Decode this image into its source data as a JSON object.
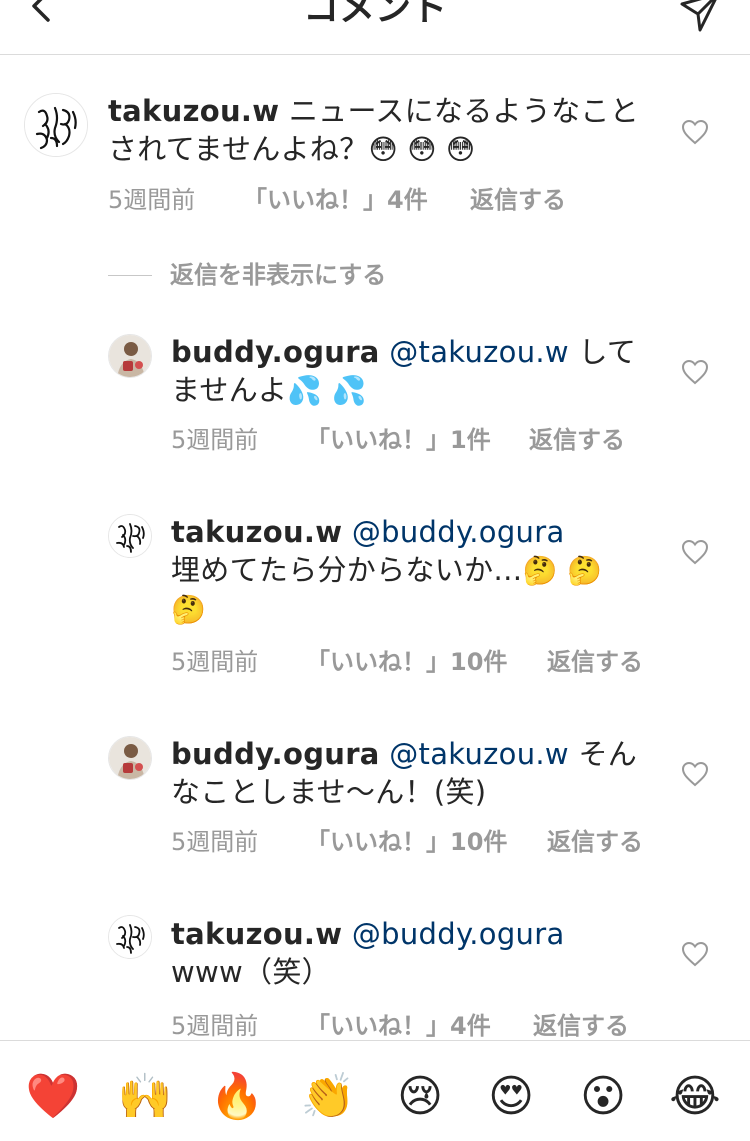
{
  "header": {
    "title": "コメント",
    "back_icon": "chevron-left-icon",
    "send_icon": "paper-plane-icon"
  },
  "comments": [
    {
      "username": "takuzou.w",
      "mention": "",
      "text_line1": " ニュースになるようなこと",
      "text_line2": "されてませんよね？",
      "emojis": "😳 😳 😳",
      "time": "5週間前",
      "likes": "「いいね！」4件",
      "reply": "返信する",
      "avatar": "calligraphy-avatar"
    },
    {
      "username": "buddy.ogura",
      "mention": "@takuzou.w",
      "text_line1": " して",
      "text_line2": "ませんよ",
      "emojis": "💦 💦",
      "time": "5週間前",
      "likes": "「いいね！」1件",
      "reply": "返信する",
      "avatar": "photo-avatar"
    },
    {
      "username": "takuzou.w",
      "mention": "@buddy.ogura",
      "text_line2": "埋めてたら分からないか…",
      "emojis_inline": "🤔 🤔",
      "emojis_line3": "🤔",
      "time": "5週間前",
      "likes": "「いいね！」10件",
      "reply": "返信する",
      "avatar": "calligraphy-avatar"
    },
    {
      "username": "buddy.ogura",
      "mention": "@takuzou.w",
      "text_line1": " そん",
      "text_line2": "なことしませ〜ん！(笑)",
      "time": "5週間前",
      "likes": "「いいね！」10件",
      "reply": "返信する",
      "avatar": "photo-avatar"
    },
    {
      "username": "takuzou.w",
      "mention": "@buddy.ogura",
      "text_line2": "www（笑）",
      "time": "5週間前",
      "likes": "「いいね！」4件",
      "reply": "返信する",
      "avatar": "calligraphy-avatar"
    }
  ],
  "hide_replies": "返信を非表示にする",
  "emoji_bar": [
    "❤️",
    "🙌",
    "🔥",
    "👏",
    "😢",
    "😍",
    "😮",
    "😂"
  ],
  "colors": {
    "text": "#262626",
    "mention": "#003569",
    "meta": "#999999",
    "divider": "#dbdbdb"
  }
}
